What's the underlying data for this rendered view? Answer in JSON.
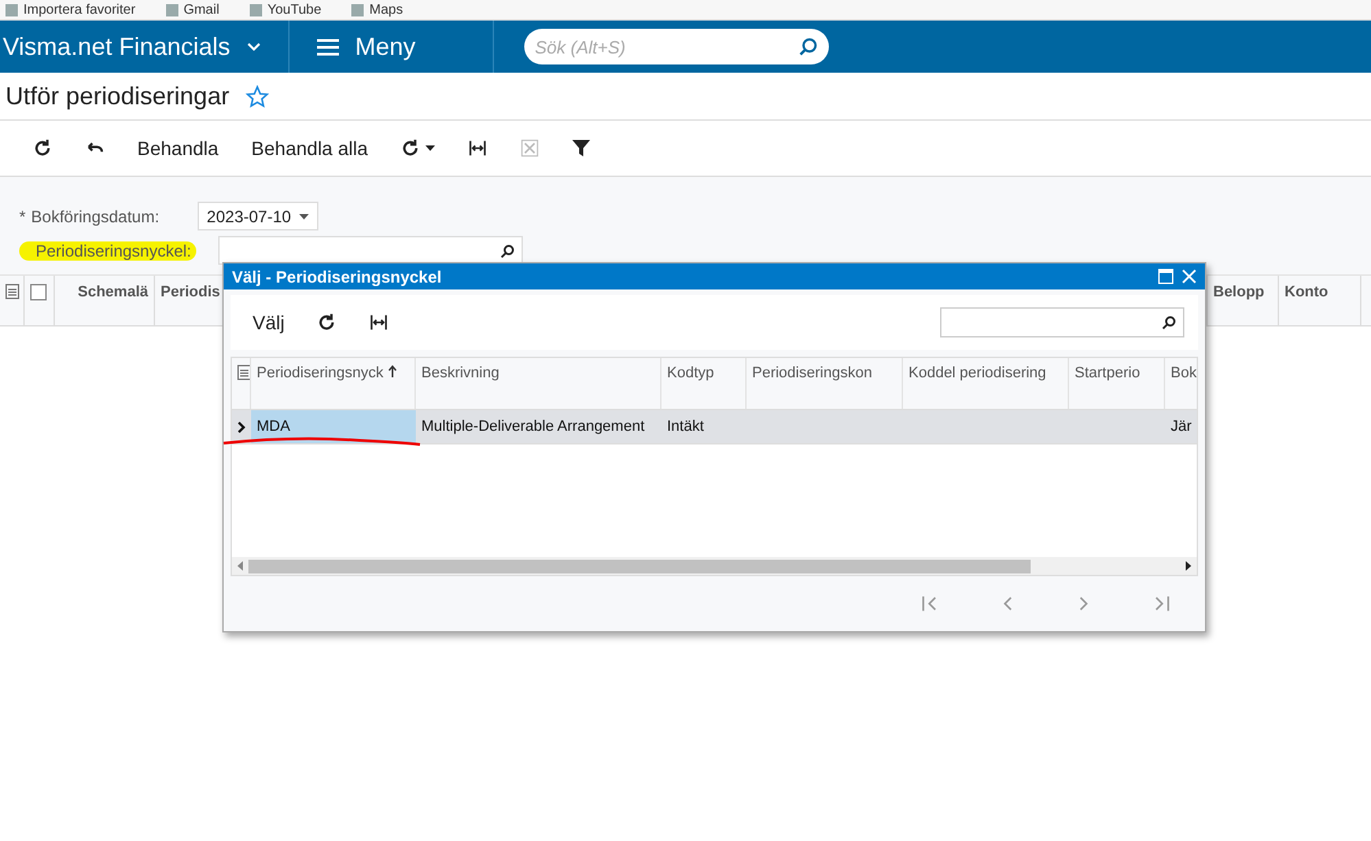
{
  "bookmarks": [
    {
      "label": "Importera favoriter"
    },
    {
      "label": "Gmail"
    },
    {
      "label": "YouTube"
    },
    {
      "label": "Maps"
    }
  ],
  "header": {
    "app_name": "Visma.net Financials",
    "menu": "Meny",
    "search": {
      "placeholder": "Sök (Alt+S)"
    }
  },
  "page": {
    "title": "Utför periodiseringar",
    "favorite": false
  },
  "toolbar": {
    "buttons": [
      "Behandla",
      "Behandla alla"
    ]
  },
  "form": {
    "fields": [
      {
        "label": "Bokföringsdatum:",
        "required_mark": "*",
        "highlighted": false,
        "kind": "date",
        "value": "2023-07-10"
      },
      {
        "label": "Periodiseringsnyckel:",
        "highlighted": true,
        "kind": "lookup"
      }
    ]
  },
  "grid": {
    "all_checked": false,
    "columns": [
      "Schemalä",
      "Periodis",
      "Belopp",
      "Konto"
    ]
  },
  "dialog": {
    "title": "Välj - Periodiseringsnyckel",
    "select_button": "Välj",
    "columns": [
      {
        "label": "Periodiseringsnyck",
        "sorted": true
      },
      {
        "label": "Beskrivning"
      },
      {
        "label": "Kodtyp"
      },
      {
        "label": "Periodiseringskon"
      },
      {
        "label": "Koddel periodisering"
      },
      {
        "label": "Startperio"
      },
      {
        "label": "Bok"
      }
    ],
    "rows": [
      {
        "selected": true,
        "cells": [
          "MDA",
          "Multiple-Deliverable Arrangement",
          "Intäkt",
          null,
          null,
          null,
          "Jär"
        ]
      }
    ]
  }
}
